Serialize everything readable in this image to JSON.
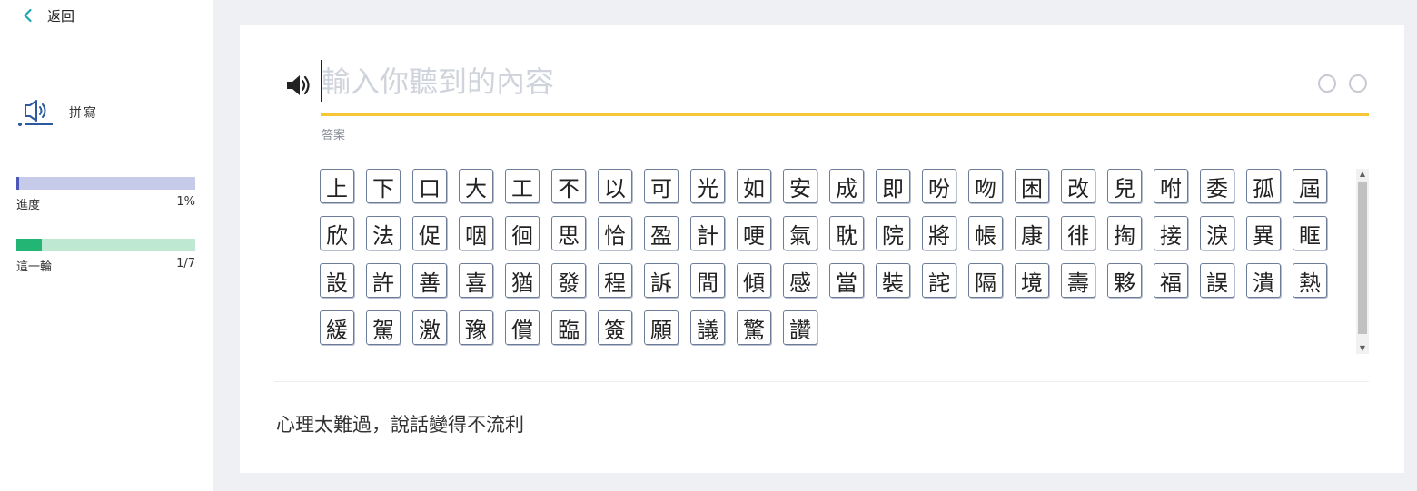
{
  "sidebar": {
    "back_label": "返回",
    "mode_label": "拼寫",
    "progress": {
      "label": "進度",
      "value_text": "1%",
      "fraction": 0.01
    },
    "round": {
      "label": "這一輪",
      "value_text": "1/7",
      "fraction": 0.143
    }
  },
  "main": {
    "input_placeholder": "輸入你聽到的內容",
    "input_value": "",
    "answer_label": "答案",
    "characters": [
      "上",
      "下",
      "口",
      "大",
      "工",
      "不",
      "以",
      "可",
      "光",
      "如",
      "安",
      "成",
      "即",
      "吩",
      "吻",
      "困",
      "改",
      "兒",
      "咐",
      "委",
      "孤",
      "屆",
      "欣",
      "法",
      "促",
      "咽",
      "徊",
      "思",
      "恰",
      "盈",
      "計",
      "哽",
      "氣",
      "耽",
      "院",
      "將",
      "帳",
      "康",
      "徘",
      "掏",
      "接",
      "淚",
      "異",
      "眶",
      "設",
      "許",
      "善",
      "喜",
      "猶",
      "發",
      "程",
      "訴",
      "間",
      "傾",
      "感",
      "當",
      "裝",
      "詫",
      "隔",
      "境",
      "壽",
      "夥",
      "福",
      "誤",
      "潰",
      "熱",
      "緩",
      "駕",
      "激",
      "豫",
      "償",
      "臨",
      "簽",
      "願",
      "議",
      "驚",
      "讚"
    ],
    "sentence": "心理太難過，說話變得不流利"
  },
  "colors": {
    "accent_yellow": "#f5c736",
    "progress_fill": "#4b58b8",
    "progress_track": "#c5cbe9",
    "round_fill": "#22b573",
    "round_track": "#bfe8d3",
    "back_arrow": "#22a5b4"
  },
  "icons": {
    "back": "chevron-left-icon",
    "mode": "speaker-icon",
    "play": "speaker-icon"
  }
}
